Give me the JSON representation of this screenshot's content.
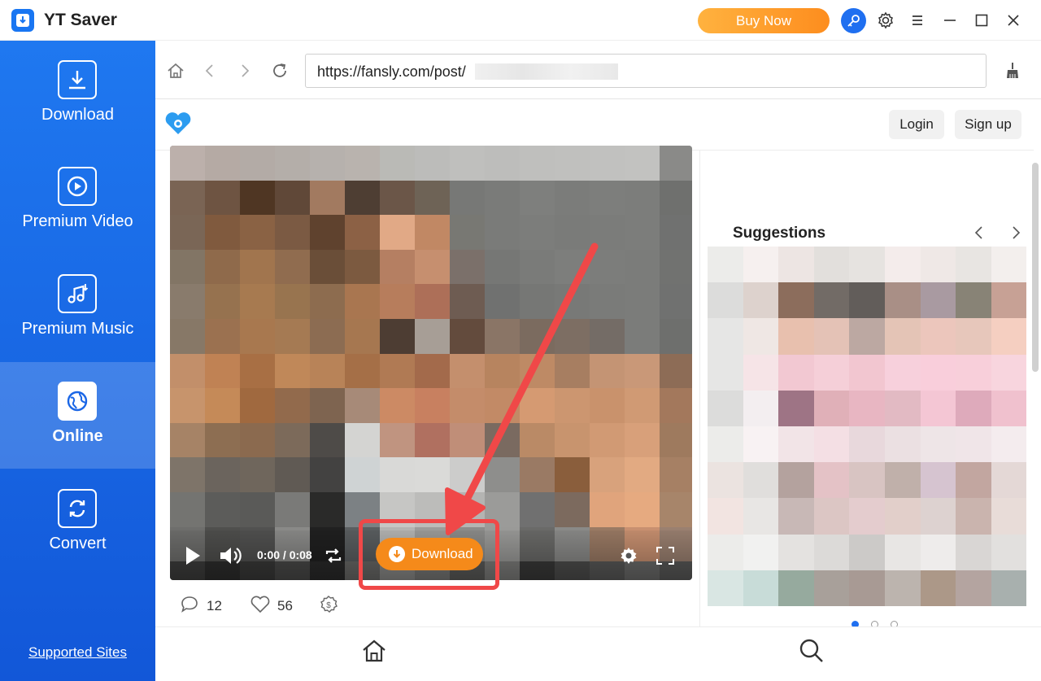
{
  "app": {
    "title": "YT Saver",
    "buy_now": "Buy Now"
  },
  "sidebar": {
    "items": [
      {
        "label": "Download",
        "icon": "download-icon",
        "active": false
      },
      {
        "label": "Premium Video",
        "icon": "play-icon",
        "active": false
      },
      {
        "label": "Premium Music",
        "icon": "music-icon",
        "active": false
      },
      {
        "label": "Online",
        "icon": "globe-icon",
        "active": true
      },
      {
        "label": "Convert",
        "icon": "convert-icon",
        "active": false
      }
    ],
    "supported_sites": "Supported Sites"
  },
  "browser": {
    "url": "https://fansly.com/post/"
  },
  "page": {
    "login": "Login",
    "signup": "Sign up",
    "video": {
      "time": "0:00 / 0:08",
      "download_label": "Download"
    },
    "stats": {
      "comments": "12",
      "likes": "56"
    },
    "suggestions": {
      "title": "Suggestions"
    }
  },
  "colors": {
    "sidebar_top": "#1f78f0",
    "sidebar_bottom": "#1257d8",
    "buy_now": "#fd8d1e",
    "download_button": "#f58a1a",
    "annotation": "#f04848",
    "brand": "#1f6ff0"
  }
}
